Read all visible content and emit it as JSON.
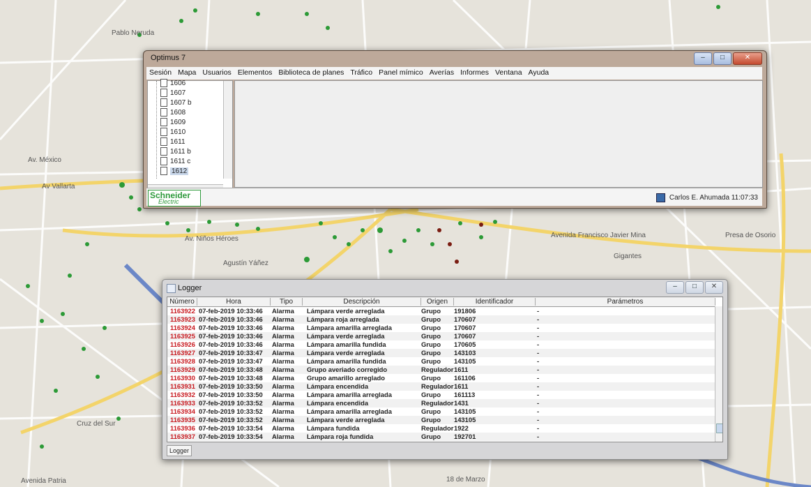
{
  "map": {
    "streets": [
      "Pablo Neruda",
      "Av. México",
      "Av Vallarta",
      "Av. Niños Héroes",
      "Agustín Yáñez",
      "Avenida Francisco Javier Mina",
      "Cruz del Sur",
      "Gigantes",
      "Avenida Patria",
      "18 de Marzo",
      "Presa de Osorio"
    ]
  },
  "optimus": {
    "title": "Optimus 7",
    "menu": [
      "Sesión",
      "Mapa",
      "Usuarios",
      "Elementos",
      "Biblioteca de planes",
      "Tráfico",
      "Panel mímico",
      "Averías",
      "Informes",
      "Ventana",
      "Ayuda"
    ],
    "tree": [
      "1606",
      "1607",
      "1607 b",
      "1608",
      "1609",
      "1610",
      "1611",
      "1611 b",
      "1611 c",
      "1612"
    ],
    "selected_tree": "1612",
    "logo_top": "Schneider",
    "logo_bottom": "Electric",
    "status_user": "Carlos E. Ahumada 11:07:33",
    "btn_min": "–",
    "btn_max": "□",
    "btn_close": "✕"
  },
  "logger": {
    "title": "Logger",
    "tab": "Logger",
    "btn_min": "–",
    "btn_max": "□",
    "btn_close": "✕",
    "columns": [
      "Número",
      "Hora",
      "Tipo",
      "Descripción",
      "Origen",
      "Identificador",
      "Parámetros"
    ],
    "rows": [
      [
        "1163922",
        "07-feb-2019 10:33:46",
        "Alarma",
        "Lámpara verde arreglada",
        "Grupo",
        "191806",
        "-"
      ],
      [
        "1163923",
        "07-feb-2019 10:33:46",
        "Alarma",
        "Lámpara roja arreglada",
        "Grupo",
        "170607",
        "-"
      ],
      [
        "1163924",
        "07-feb-2019 10:33:46",
        "Alarma",
        "Lámpara amarilla arreglada",
        "Grupo",
        "170607",
        "-"
      ],
      [
        "1163925",
        "07-feb-2019 10:33:46",
        "Alarma",
        "Lámpara verde arreglada",
        "Grupo",
        "170607",
        "-"
      ],
      [
        "1163926",
        "07-feb-2019 10:33:46",
        "Alarma",
        "Lámpara amarilla fundida",
        "Grupo",
        "170605",
        "-"
      ],
      [
        "1163927",
        "07-feb-2019 10:33:47",
        "Alarma",
        "Lámpara verde arreglada",
        "Grupo",
        "143103",
        "-"
      ],
      [
        "1163928",
        "07-feb-2019 10:33:47",
        "Alarma",
        "Lámpara amarilla fundida",
        "Grupo",
        "143105",
        "-"
      ],
      [
        "1163929",
        "07-feb-2019 10:33:48",
        "Alarma",
        "Grupo averiado corregido",
        "Regulador",
        "1611",
        "-"
      ],
      [
        "1163930",
        "07-feb-2019 10:33:48",
        "Alarma",
        "Grupo amarillo arreglado",
        "Grupo",
        "161106",
        "-"
      ],
      [
        "1163931",
        "07-feb-2019 10:33:50",
        "Alarma",
        "Lámpara encendida",
        "Regulador",
        "1611",
        "-"
      ],
      [
        "1163932",
        "07-feb-2019 10:33:50",
        "Alarma",
        "Lámpara amarilla arreglada",
        "Grupo",
        "161113",
        "-"
      ],
      [
        "1163933",
        "07-feb-2019 10:33:52",
        "Alarma",
        "Lámpara encendida",
        "Regulador",
        "1431",
        "-"
      ],
      [
        "1163934",
        "07-feb-2019 10:33:52",
        "Alarma",
        "Lámpara amarilla arreglada",
        "Grupo",
        "143105",
        "-"
      ],
      [
        "1163935",
        "07-feb-2019 10:33:52",
        "Alarma",
        "Lámpara verde arreglada",
        "Grupo",
        "143105",
        "-"
      ],
      [
        "1163936",
        "07-feb-2019 10:33:54",
        "Alarma",
        "Lámpara fundida",
        "Regulador",
        "1922",
        "-"
      ],
      [
        "1163937",
        "07-feb-2019 10:33:54",
        "Alarma",
        "Lámpara roja fundida",
        "Grupo",
        "192701",
        "-"
      ]
    ]
  },
  "colors": {
    "number_red": "#c8191f",
    "signal_green": "#2c9a36",
    "brand_green": "#2e9a3c"
  }
}
